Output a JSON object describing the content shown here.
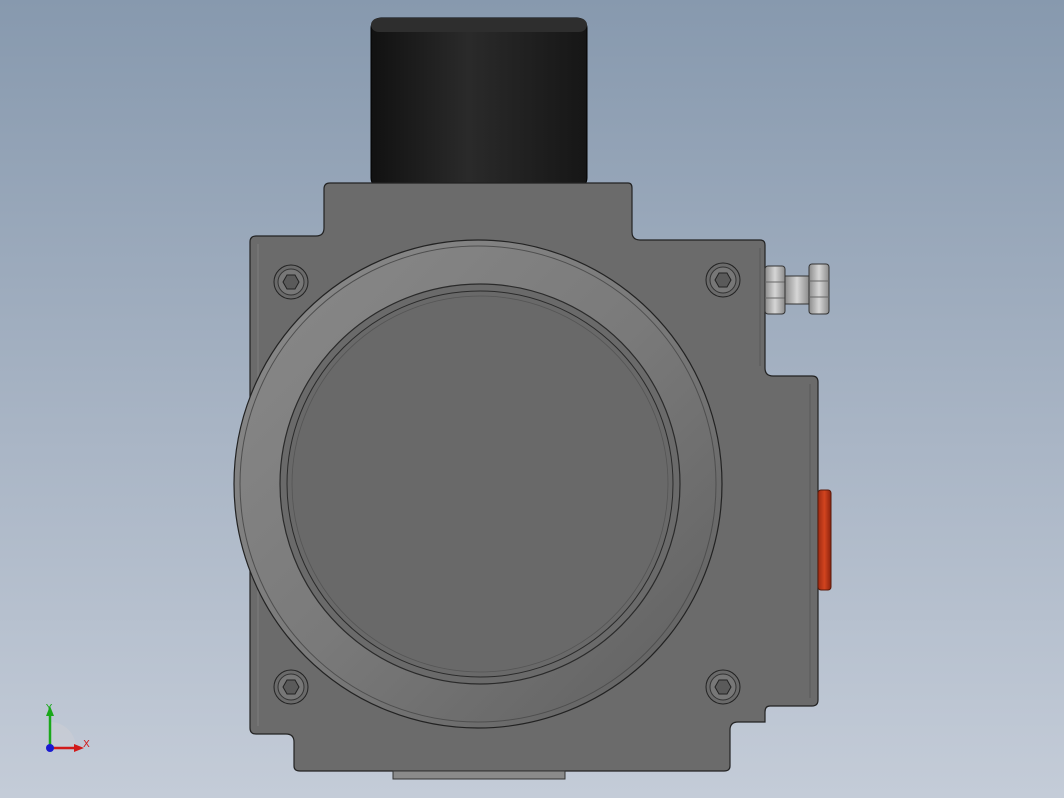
{
  "viewport": {
    "background_top": "#8799ae",
    "background_bottom": "#c4ccd8"
  },
  "model": {
    "body_color": "#6b6b6b",
    "cap_color": "#1e1e1e",
    "indicator_color": "#c0391b",
    "fitting_color": "#b8b8b8"
  },
  "triad": {
    "y_label": "Y",
    "x_label": "X",
    "y_color": "#1aa81a",
    "x_color": "#d11a1a",
    "z_color": "#1a1ad1"
  }
}
